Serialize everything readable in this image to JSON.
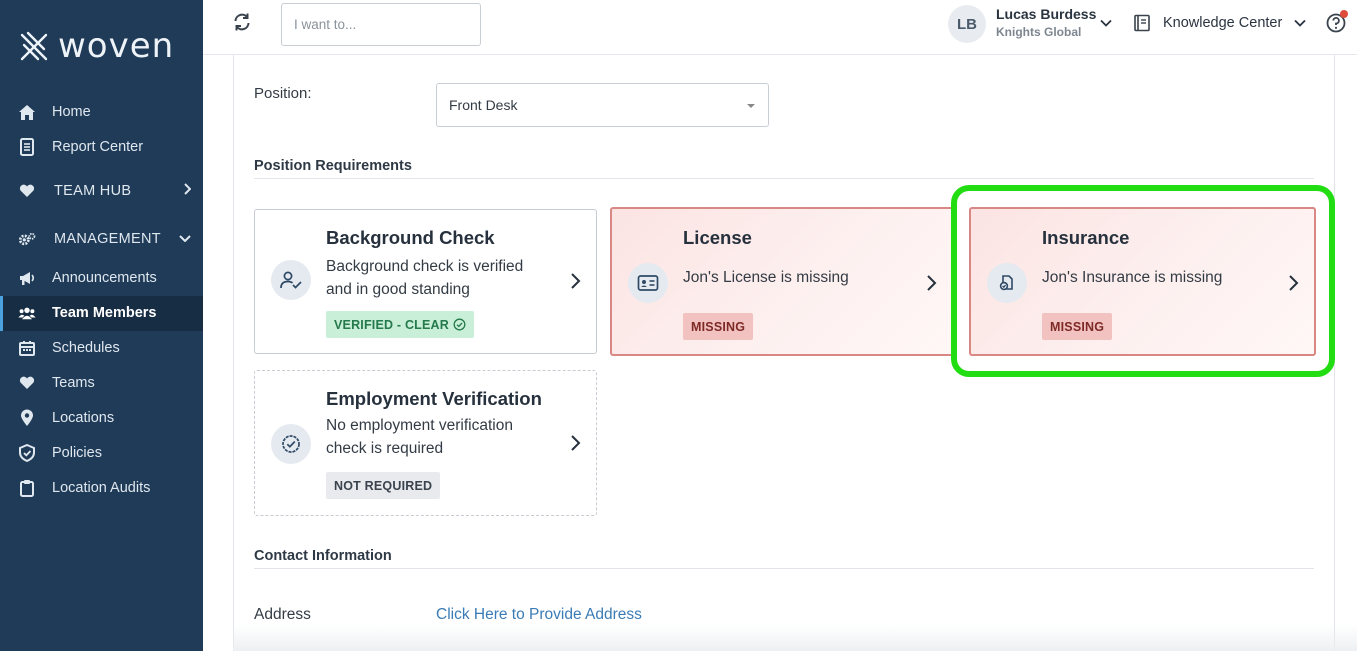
{
  "sidebar": {
    "brand": "woven",
    "items": [
      {
        "name": "home",
        "label": "Home",
        "icon": "home-icon"
      },
      {
        "name": "report-center",
        "label": "Report Center",
        "icon": "report-icon"
      },
      {
        "name": "team-hub",
        "label": "TEAM HUB",
        "icon": "heart-icon"
      },
      {
        "name": "management",
        "label": "MANAGEMENT",
        "icon": "gears-icon"
      },
      {
        "name": "announcements",
        "label": "Announcements",
        "icon": "megaphone-icon"
      },
      {
        "name": "team-members",
        "label": "Team Members",
        "icon": "users-icon"
      },
      {
        "name": "schedules",
        "label": "Schedules",
        "icon": "calendar-icon"
      },
      {
        "name": "teams",
        "label": "Teams",
        "icon": "heart-icon"
      },
      {
        "name": "locations",
        "label": "Locations",
        "icon": "map-pin-icon"
      },
      {
        "name": "policies",
        "label": "Policies",
        "icon": "shield-icon"
      },
      {
        "name": "location-audits",
        "label": "Location Audits",
        "icon": "clipboard-icon"
      }
    ],
    "active": "Team Members"
  },
  "header": {
    "search_placeholder": "I want to...",
    "user_initials": "LB",
    "user_name": "Lucas Burdess",
    "user_org": "Knights Global",
    "knowledge_center": "Knowledge Center"
  },
  "position": {
    "label": "Position:",
    "value": "Front Desk"
  },
  "requirements": {
    "title": "Position Requirements",
    "cards": [
      {
        "title": "Background Check",
        "desc": "Background check is verified and in good standing",
        "badge": "VERIFIED - CLEAR",
        "status": "verified"
      },
      {
        "title": "License",
        "desc": "Jon's License is missing",
        "badge": "MISSING",
        "status": "missing"
      },
      {
        "title": "Insurance",
        "desc": "Jon's Insurance is missing",
        "badge": "MISSING",
        "status": "missing"
      },
      {
        "title": "Employment Verification",
        "desc": "No employment verification check is required",
        "badge": "NOT REQUIRED",
        "status": "not-required"
      }
    ]
  },
  "contact": {
    "title": "Contact Information",
    "address_label": "Address",
    "address_link": "Click Here to Provide Address"
  },
  "colors": {
    "sidebar_bg": "#1f3b57",
    "highlight": "#22dd11",
    "link": "#3a7bb5"
  }
}
